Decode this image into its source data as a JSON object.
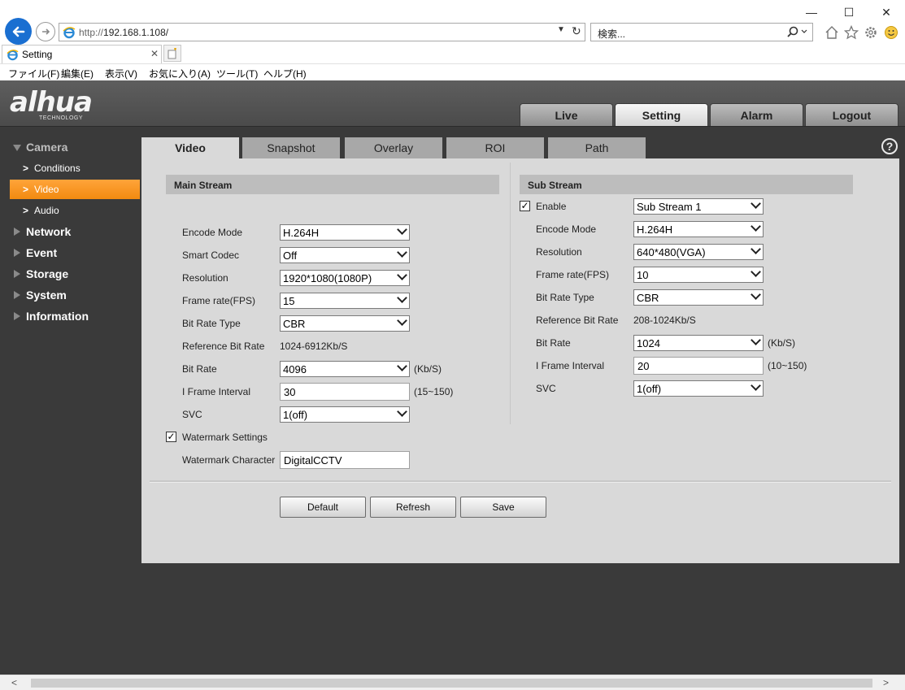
{
  "browser": {
    "window_controls": {
      "minimize": "—",
      "maximize": "☐",
      "close": "✕"
    },
    "url_prefix": "http://",
    "url_host": "192.168.1.108/",
    "search_placeholder": "検索...",
    "tab_title": "Setting",
    "menu": [
      "ファイル(F)",
      "編集(E)",
      "表示(V)",
      "お気に入り(A)",
      "ツール(T)",
      "ヘルプ(H)"
    ]
  },
  "app": {
    "logo": "alhua",
    "logo_sub": "TECHNOLOGY",
    "top_tabs": [
      "Live",
      "Setting",
      "Alarm",
      "Logout"
    ],
    "active_top_tab": "Setting"
  },
  "sidebar": {
    "camera": "Camera",
    "conditions": "Conditions",
    "video": "Video",
    "audio": "Audio",
    "network": "Network",
    "event": "Event",
    "storage": "Storage",
    "system": "System",
    "information": "Information"
  },
  "sub_tabs": [
    "Video",
    "Snapshot",
    "Overlay",
    "ROI",
    "Path"
  ],
  "main_stream": {
    "title": "Main Stream",
    "encode_mode_label": "Encode Mode",
    "encode_mode": "H.264H",
    "smart_codec_label": "Smart Codec",
    "smart_codec": "Off",
    "resolution_label": "Resolution",
    "resolution": "1920*1080(1080P)",
    "frame_rate_label": "Frame rate(FPS)",
    "frame_rate": "15",
    "bit_rate_type_label": "Bit Rate Type",
    "bit_rate_type": "CBR",
    "ref_bit_rate_label": "Reference Bit Rate",
    "ref_bit_rate": "1024-6912Kb/S",
    "bit_rate_label": "Bit Rate",
    "bit_rate": "4096",
    "bit_rate_unit": "(Kb/S)",
    "iframe_label": "I Frame Interval",
    "iframe": "30",
    "iframe_range": "(15~150)",
    "svc_label": "SVC",
    "svc": "1(off)",
    "watermark_settings_label": "Watermark Settings",
    "watermark_checked": true,
    "watermark_char_label": "Watermark Character",
    "watermark_char": "DigitalCCTV"
  },
  "sub_stream": {
    "title": "Sub Stream",
    "enable_label": "Enable",
    "enable_checked": true,
    "stream": "Sub Stream 1",
    "encode_mode_label": "Encode Mode",
    "encode_mode": "H.264H",
    "resolution_label": "Resolution",
    "resolution": "640*480(VGA)",
    "frame_rate_label": "Frame rate(FPS)",
    "frame_rate": "10",
    "bit_rate_type_label": "Bit Rate Type",
    "bit_rate_type": "CBR",
    "ref_bit_rate_label": "Reference Bit Rate",
    "ref_bit_rate": "208-1024Kb/S",
    "bit_rate_label": "Bit Rate",
    "bit_rate": "1024",
    "bit_rate_unit": "(Kb/S)",
    "iframe_label": "I Frame Interval",
    "iframe": "20",
    "iframe_range": "(10~150)",
    "svc_label": "SVC",
    "svc": "1(off)"
  },
  "buttons": {
    "default": "Default",
    "refresh": "Refresh",
    "save": "Save"
  },
  "colors": {
    "accent": "#f28a10",
    "chrome_bg": "#3a3a3a",
    "panel_bg": "#d9d9d9",
    "ie_blue": "#1a6fd1"
  }
}
